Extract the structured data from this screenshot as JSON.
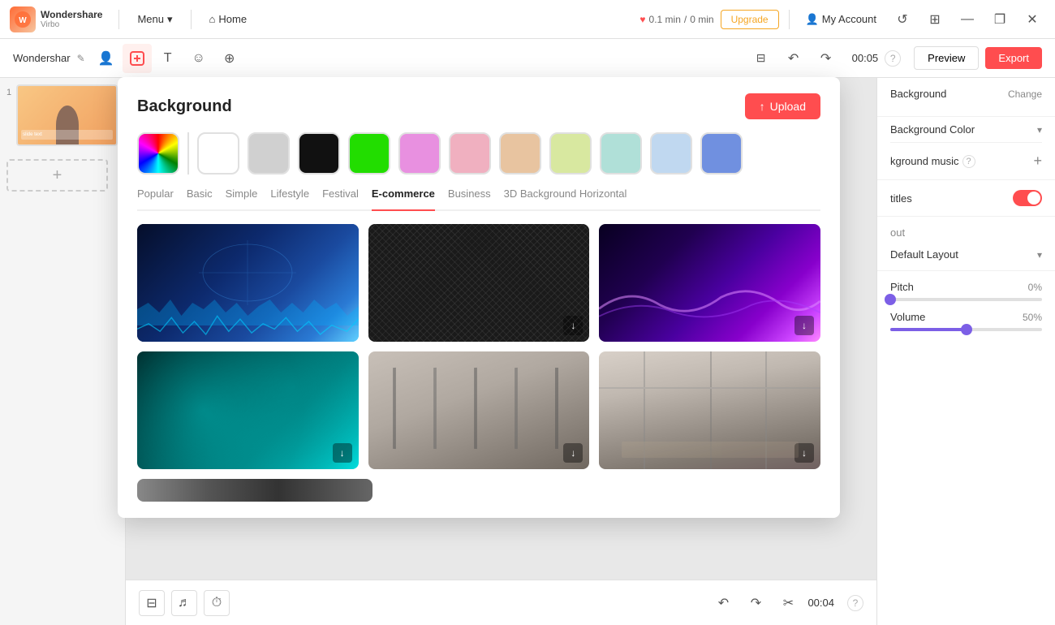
{
  "app": {
    "logo_main": "Wondershare",
    "logo_sub": "Virbo"
  },
  "topbar": {
    "menu_label": "Menu",
    "home_label": "Home",
    "time_used": "0.1 min",
    "divider": "/",
    "time_total": "0 min",
    "upgrade_label": "Upgrade",
    "account_label": "My Account"
  },
  "secondbar": {
    "project_name": "Wondershar",
    "time_display": "00:05",
    "preview_label": "Preview",
    "export_label": "Export"
  },
  "modal": {
    "title": "Background",
    "upload_label": "Upload",
    "categories": [
      "Popular",
      "Basic",
      "Simple",
      "Lifestyle",
      "Festival",
      "E-commerce",
      "Business",
      "3D Background Horizontal"
    ],
    "active_category": "E-commerce",
    "bg_images": [
      {
        "type": "tech",
        "has_download": true
      },
      {
        "type": "carbon",
        "has_download": true
      },
      {
        "type": "purple_wave",
        "has_download": true
      },
      {
        "type": "teal",
        "has_download": true
      },
      {
        "type": "office1",
        "has_download": true
      },
      {
        "type": "office2",
        "has_download": true
      }
    ]
  },
  "right_panel": {
    "background_label": "Background",
    "change_label": "Change",
    "bg_color_label": "Background Color",
    "music_label": "kground music",
    "music_help": "?",
    "subtitles_label": "titles",
    "layout_label": "out",
    "layout_value": "Default Layout"
  },
  "bottom_right": {
    "pitch_label": "Pitch",
    "pitch_value": "0%",
    "volume_label": "Volume",
    "volume_value": "50%",
    "pitch_percent": 0,
    "volume_percent": 50
  },
  "bottom_bar": {
    "time_display": "00:04",
    "help": "?"
  },
  "swatches": [
    "gradient",
    "white",
    "lightgray",
    "gray",
    "black",
    "green",
    "lightpurple",
    "lightpink",
    "peach",
    "lime",
    "mint",
    "lightblue",
    "blue"
  ]
}
